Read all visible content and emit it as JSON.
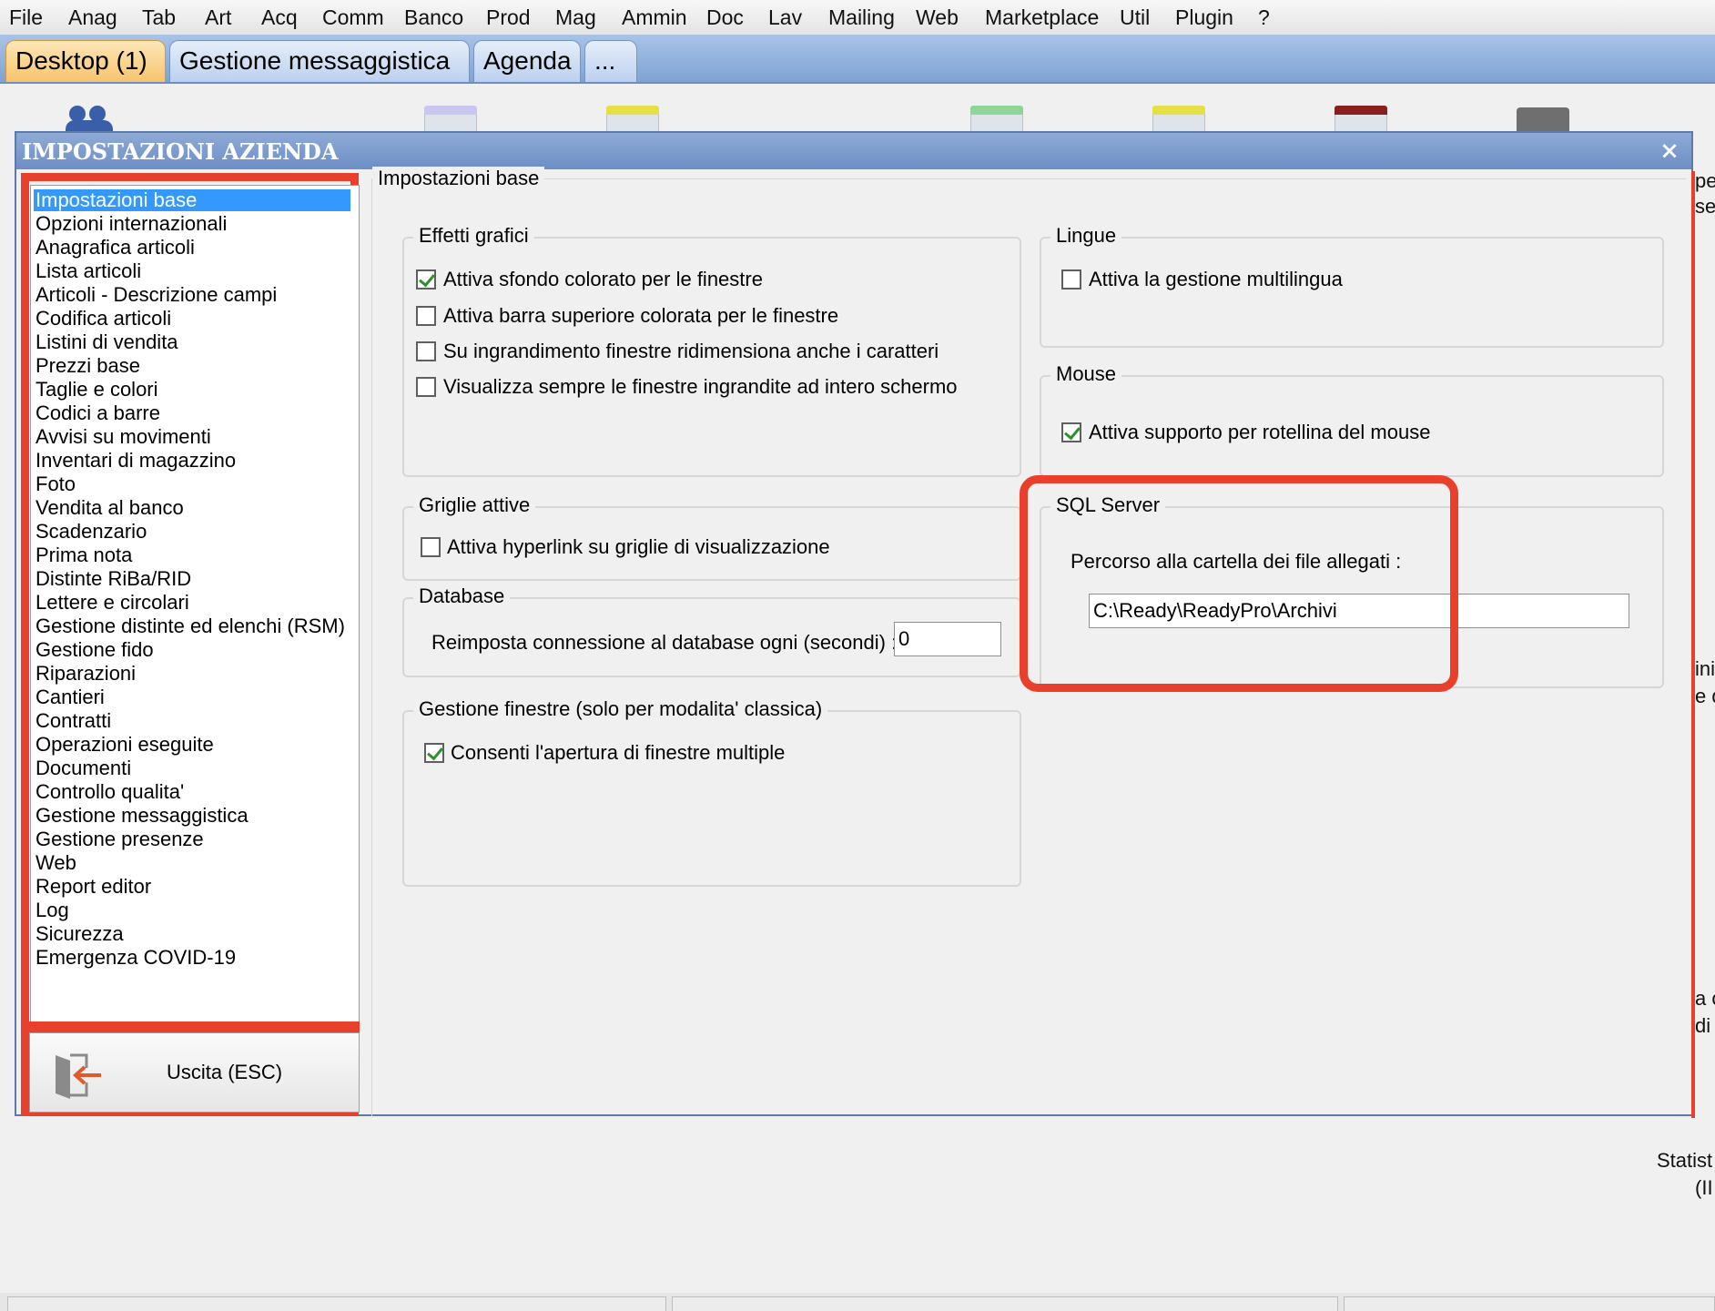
{
  "menu": [
    "File",
    "Anag",
    "Tab",
    "Art",
    "Acq",
    "Comm",
    "Banco",
    "Prod",
    "Mag",
    "Ammin",
    "Doc",
    "Lav",
    "Mailing",
    "Web",
    "Marketplace",
    "Util",
    "Plugin",
    "?"
  ],
  "tabs": [
    "Desktop (1)",
    "Gestione messaggistica",
    "Agenda",
    "..."
  ],
  "background_text": {
    "right_fragments": [
      "pe",
      "se",
      "ini",
      "e d",
      "a c",
      "di",
      "Statist",
      "(II"
    ]
  },
  "window": {
    "title": "IMPOSTAZIONI AZIENDA",
    "close_glyph": "×",
    "nav_items": [
      "Impostazioni base",
      "Opzioni internazionali",
      "Anagrafica articoli",
      "Lista articoli",
      "Articoli - Descrizione campi",
      "Codifica articoli",
      "Listini di vendita",
      "Prezzi base",
      "Taglie e colori",
      "Codici a barre",
      "Avvisi su movimenti",
      "Inventari di magazzino",
      "Foto",
      "Vendita al banco",
      "Scadenzario",
      "Prima nota",
      "Distinte RiBa/RID",
      "Lettere e circolari",
      "Gestione distinte ed elenchi (RSM)",
      "Gestione fido",
      "Riparazioni",
      "Cantieri",
      "Contratti",
      "Operazioni eseguite",
      "Documenti",
      "Controllo qualita'",
      "Gestione messaggistica",
      "Gestione presenze",
      "Web",
      "Report editor",
      "Log",
      "Sicurezza",
      "Emergenza COVID-19"
    ],
    "selected_nav": "Impostazioni base",
    "exit_label": "Uscita (ESC)",
    "panel_title": "Impostazioni base",
    "effetti_grafici": {
      "title": "Effetti grafici",
      "options": [
        {
          "label": "Attiva sfondo colorato per le finestre",
          "checked": true
        },
        {
          "label": "Attiva barra superiore colorata per le finestre",
          "checked": false
        },
        {
          "label": "Su ingrandimento finestre ridimensiona anche i caratteri",
          "checked": false
        },
        {
          "label": "Visualizza sempre le finestre ingrandite ad intero schermo",
          "checked": false
        }
      ]
    },
    "griglie": {
      "title": "Griglie attive",
      "option": {
        "label": "Attiva hyperlink su griglie di visualizzazione",
        "checked": false
      }
    },
    "database": {
      "title": "Database",
      "label": "Reimposta connessione al database ogni (secondi) :",
      "value": "0"
    },
    "gestione_finestre": {
      "title": "Gestione finestre (solo per modalita' classica)",
      "option": {
        "label": "Consenti l'apertura di finestre multiple",
        "checked": true
      }
    },
    "lingue": {
      "title": "Lingue",
      "option": {
        "label": "Attiva la gestione multilingua",
        "checked": false
      }
    },
    "mouse": {
      "title": "Mouse",
      "option": {
        "label": "Attiva supporto per rotellina del mouse",
        "checked": true
      }
    },
    "sql_server": {
      "title": "SQL Server",
      "label": "Percorso alla cartella dei file allegati :",
      "value": "C:\\Ready\\ReadyPro\\Archivi"
    }
  },
  "colors": {
    "highlight": "#e8402d",
    "selection": "#3399ff",
    "titlebar": "#7393c9",
    "active_tab": "#f7c46c"
  }
}
